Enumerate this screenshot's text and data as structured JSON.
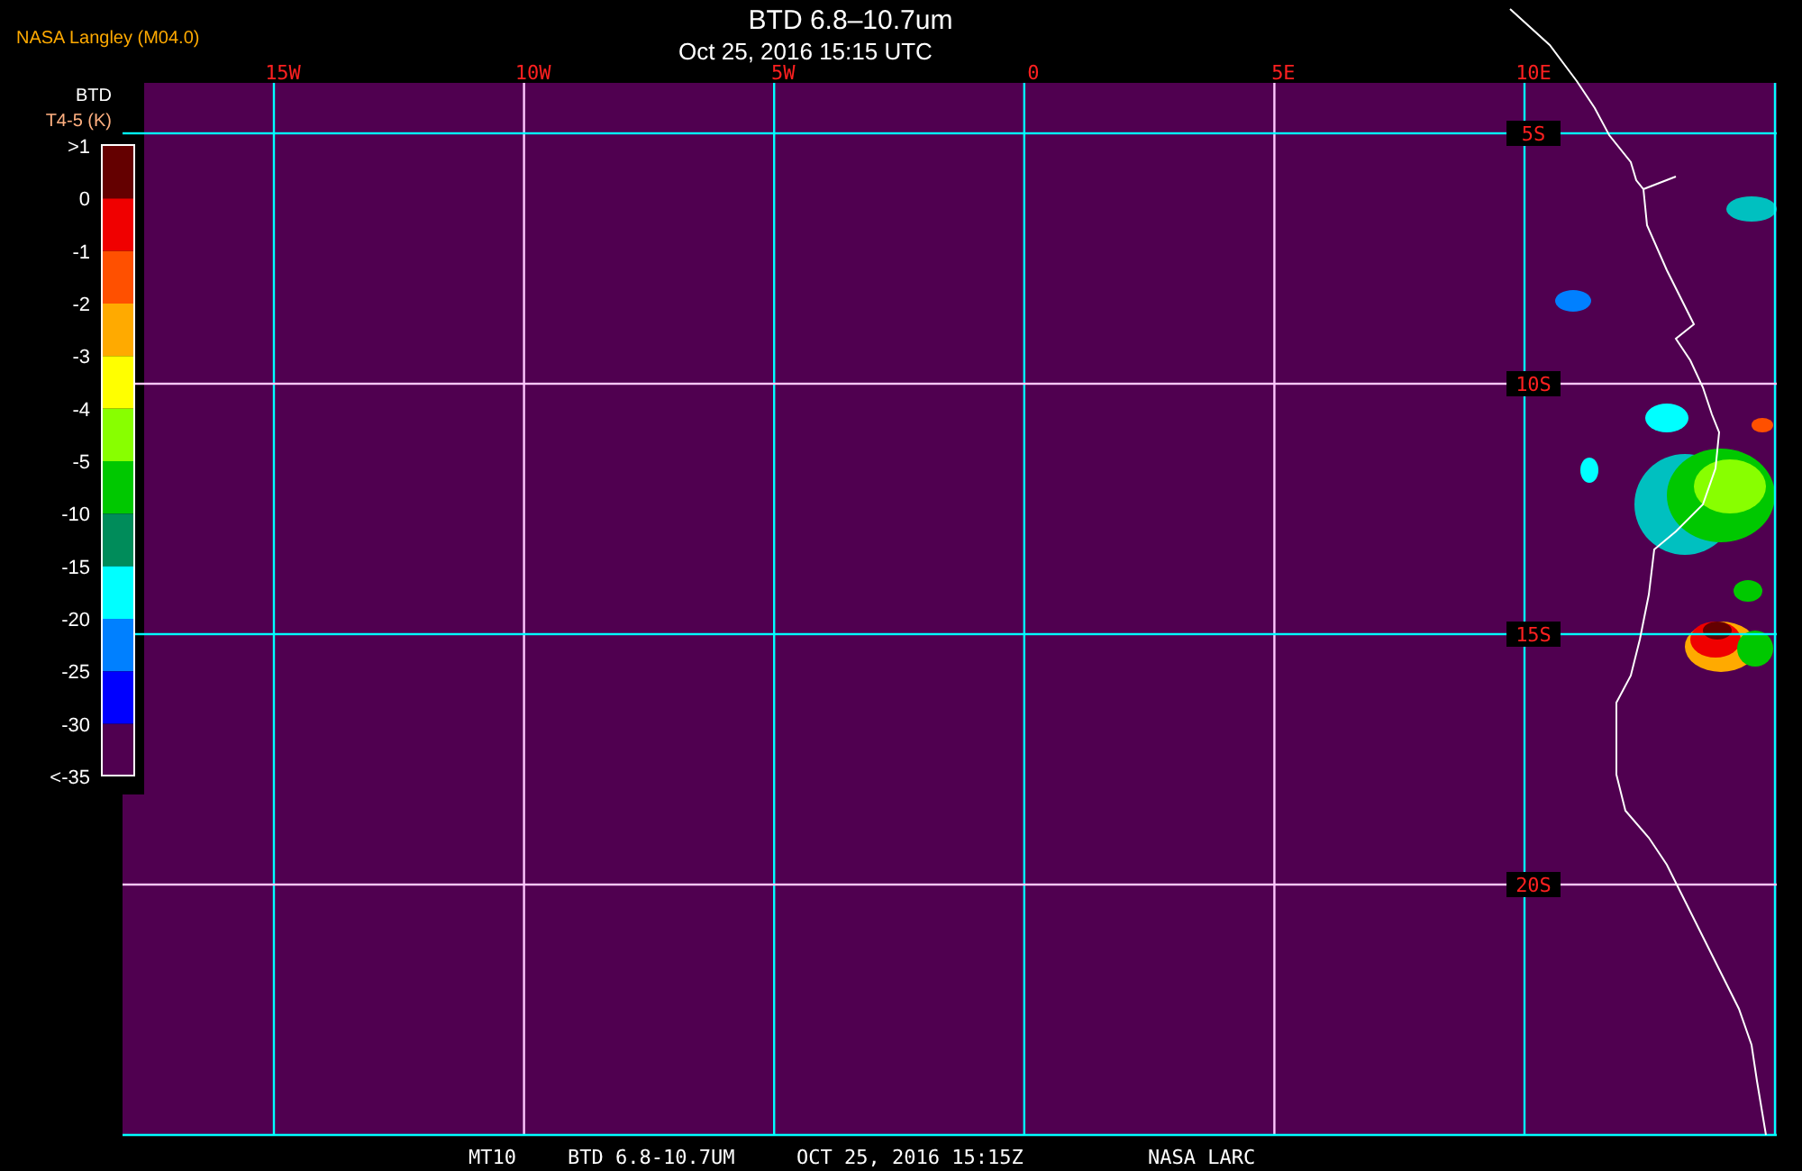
{
  "header": {
    "source": "NASA Langley (M04.0)",
    "title": "BTD 6.8–10.7um",
    "timestamp": "Oct 25, 2016 15:15 UTC"
  },
  "legend": {
    "title": "BTD",
    "units": "T4-5 (K)",
    "labels": [
      ">1",
      "0",
      "-1",
      "-2",
      "-3",
      "-4",
      "-5",
      "-10",
      "-15",
      "-20",
      "-25",
      "-30",
      "<-35"
    ],
    "bins": [
      {
        "color": "#640000"
      },
      {
        "color": "#f00000"
      },
      {
        "color": "#ff5000"
      },
      {
        "color": "#ffaa00"
      },
      {
        "color": "#ffff00"
      },
      {
        "color": "#88ff00"
      },
      {
        "color": "#00c800"
      },
      {
        "color": "#008c5a"
      },
      {
        "color": "#00ffff"
      },
      {
        "color": "#0080ff"
      },
      {
        "color": "#0000ff"
      },
      {
        "color": "#500050"
      }
    ]
  },
  "map": {
    "longitude_labels": [
      "15W",
      "10W",
      "5W",
      "0",
      "5E",
      "10E"
    ],
    "latitude_labels": [
      "5S",
      "10S",
      "15S",
      "20S"
    ],
    "meridians": [
      {
        "color": "#00ffff"
      },
      {
        "color": "#ffc8ff"
      },
      {
        "color": "#00ffff"
      },
      {
        "color": "#00ffff"
      },
      {
        "color": "#ffc8ff"
      },
      {
        "color": "#00ffff"
      }
    ],
    "parallels": [
      {
        "color": "#00ffff"
      },
      {
        "color": "#ffc8ff"
      },
      {
        "color": "#00ffff"
      },
      {
        "color": "#ffc8ff"
      }
    ]
  },
  "footer": [
    "MT10",
    "BTD 6.8-10.7UM",
    "OCT 25, 2016 15:15Z",
    "NASA LARC"
  ]
}
